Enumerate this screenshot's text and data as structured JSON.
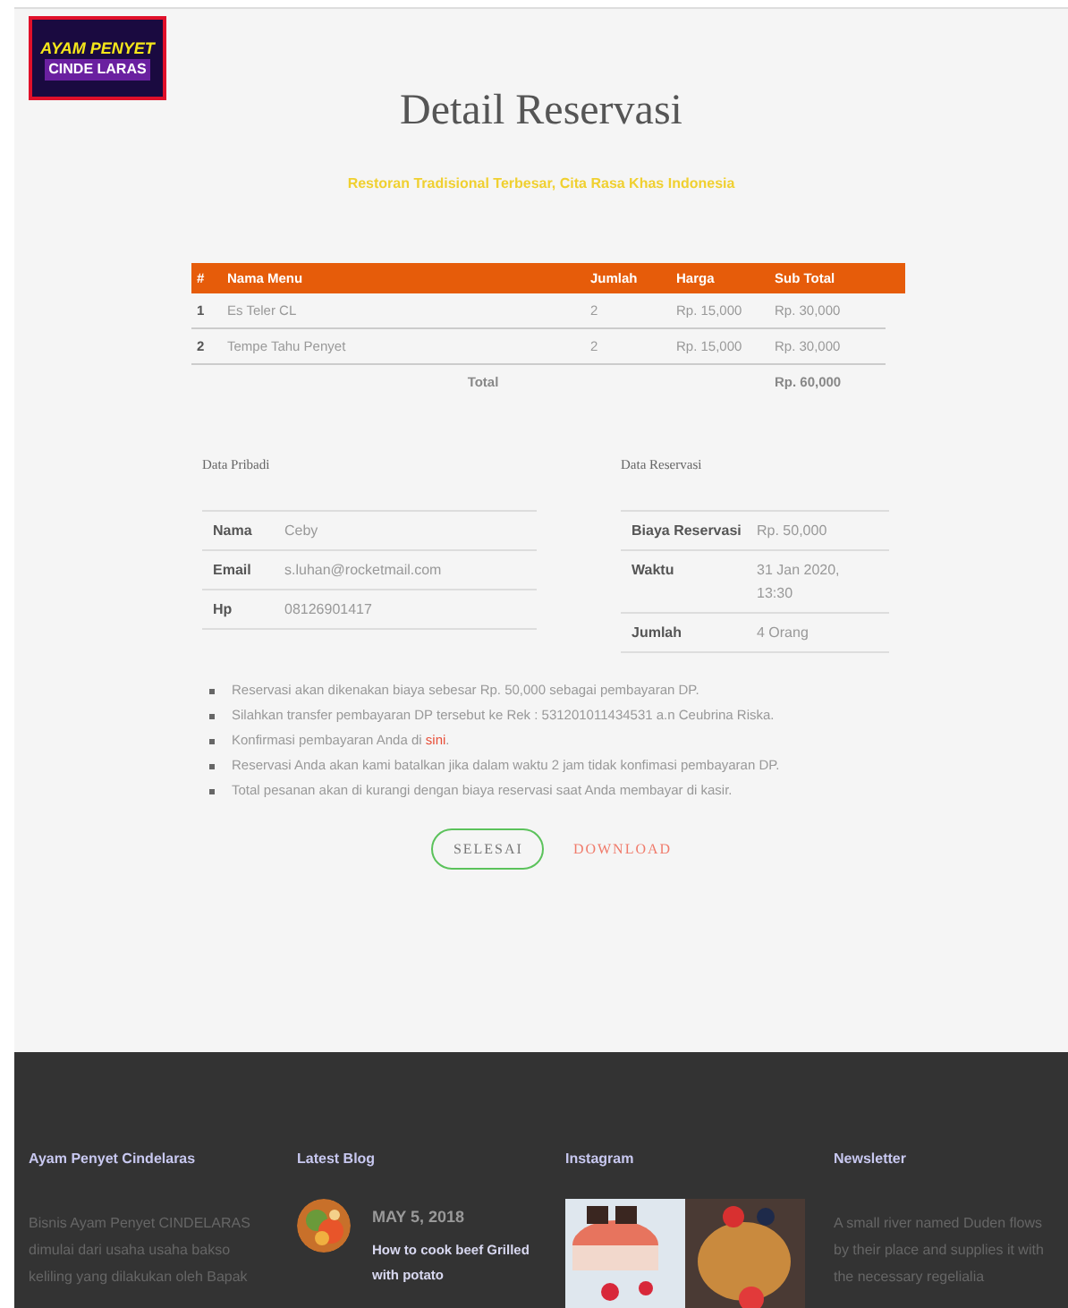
{
  "logo": {
    "top": "AYAM PENYET",
    "bottom": "CINDE LARAS"
  },
  "title": "Detail Reservasi",
  "subtitle": "Restoran Tradisional Terbesar, Cita Rasa Khas Indonesia",
  "order_table": {
    "columns": [
      "#",
      "Nama Menu",
      "Jumlah",
      "Harga",
      "Sub Total"
    ],
    "rows": [
      [
        "1",
        "Es Teler CL",
        "2",
        "Rp. 15,000",
        "Rp. 30,000"
      ],
      [
        "2",
        "Tempe Tahu Penyet",
        "2",
        "Rp. 15,000",
        "Rp. 30,000"
      ]
    ],
    "total_label": "Total",
    "total_value": "Rp. 60,000"
  },
  "personal": {
    "heading": "Data Pribadi",
    "rows": [
      {
        "label": "Nama",
        "value": "Ceby"
      },
      {
        "label": "Email",
        "value": "s.luhan@rocketmail.com"
      },
      {
        "label": "Hp",
        "value": "08126901417"
      }
    ]
  },
  "reservation": {
    "heading": "Data Reservasi",
    "rows": [
      {
        "label": "Biaya Reservasi",
        "value": "Rp. 50,000"
      },
      {
        "label": "Waktu",
        "value": "31 Jan 2020, 13:30"
      },
      {
        "label": "Jumlah",
        "value": "4 Orang"
      }
    ]
  },
  "notes": [
    {
      "text": "Reservasi akan dikenakan biaya sebesar Rp. 50,000 sebagai pembayaran DP."
    },
    {
      "text": "Silahkan transfer pembayaran DP tersebut ke Rek : 531201011434531 a.n Ceubrina Riska."
    },
    {
      "text": "Konfirmasi pembayaran Anda di ",
      "link": "sini",
      "after": "."
    },
    {
      "text": "Reservasi Anda akan kami batalkan jika dalam waktu 2 jam tidak konfimasi pembayaran DP."
    },
    {
      "text": "Total pesanan akan di kurangi dengan biaya reservasi saat Anda membayar di kasir."
    }
  ],
  "buttons": [
    {
      "label": "SELESAI",
      "kind": "outline"
    },
    {
      "label": "DOWNLOAD",
      "kind": "text"
    }
  ],
  "footer": {
    "about": {
      "heading": "Ayam Penyet Cindelaras",
      "text": "Bisnis Ayam Penyet CINDELARAS dimulai dari usaha usaha bakso keliling yang dilakukan oleh Bapak"
    },
    "blog": {
      "heading": "Latest Blog",
      "posts": [
        {
          "date": "MAY 5, 2018",
          "title": "How to cook beef Grilled with potato"
        }
      ]
    },
    "instagram": {
      "heading": "Instagram"
    },
    "newsletter": {
      "heading": "Newsletter",
      "text": "A small river named Duden flows by their place and supplies it with the necessary regelialia"
    }
  }
}
